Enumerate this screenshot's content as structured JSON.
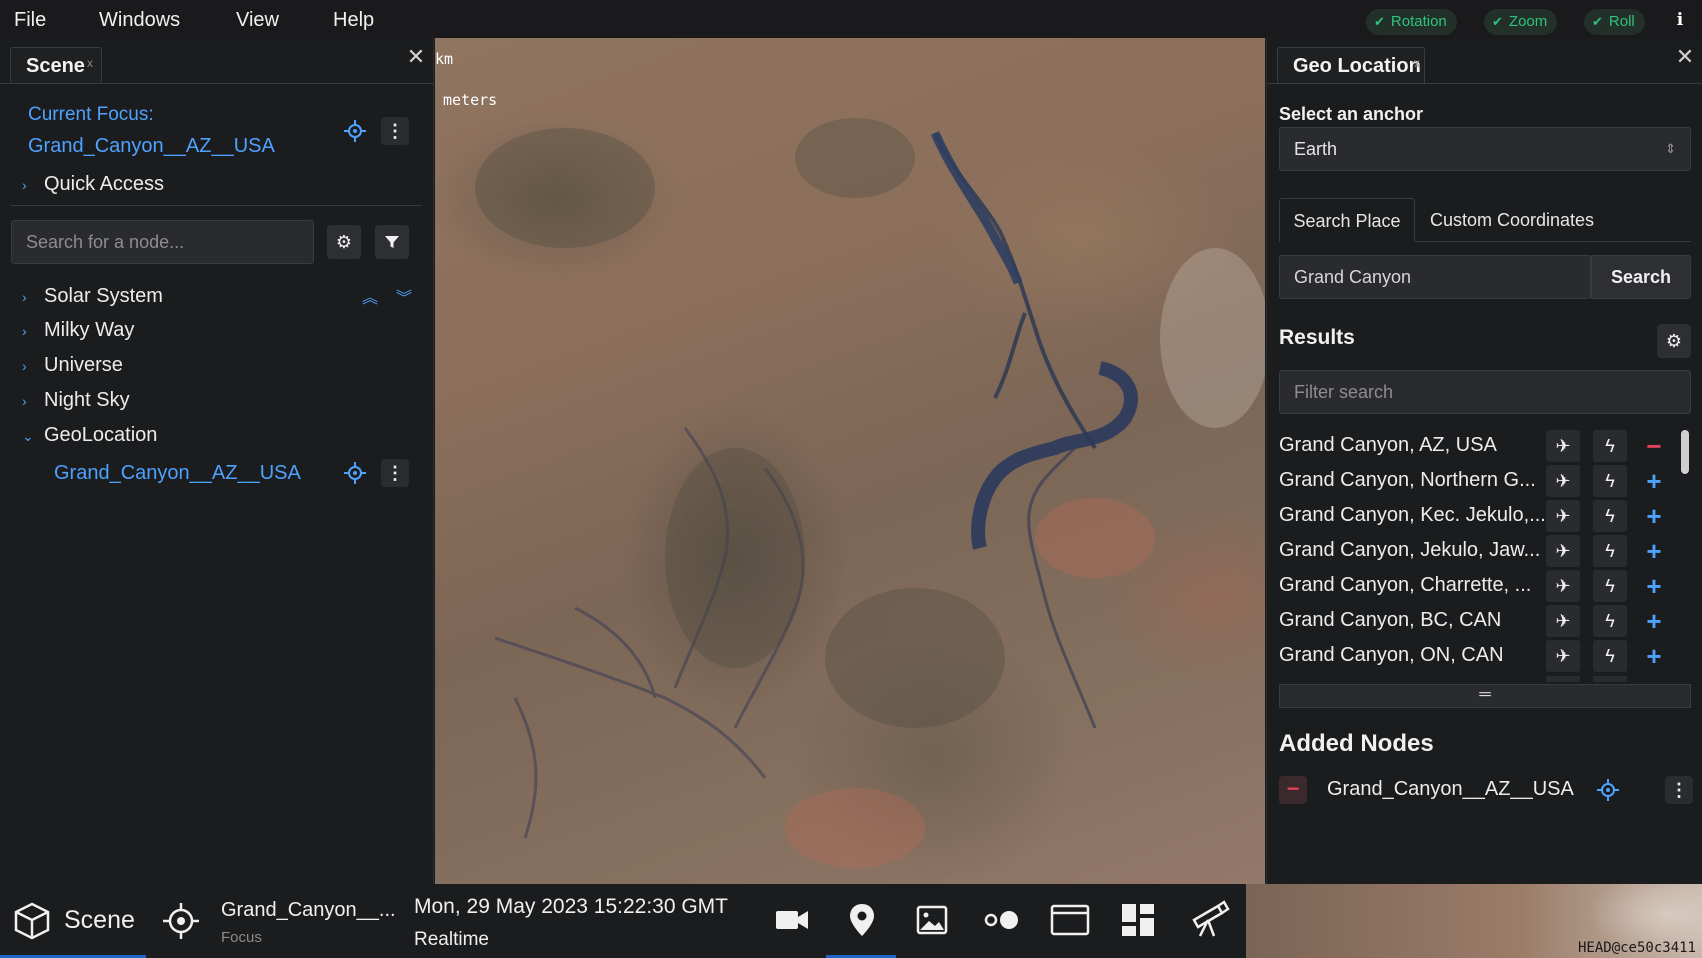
{
  "menu": {
    "file": "File",
    "windows": "Windows",
    "view": "View",
    "help": "Help"
  },
  "toggles": [
    {
      "label": "Rotation",
      "check": "✔"
    },
    {
      "label": "Zoom",
      "check": "✔"
    },
    {
      "label": "Roll",
      "check": "✔"
    }
  ],
  "info_icon": "i",
  "scene_panel": {
    "tab_title": "Scene",
    "tab_close": "x",
    "current_focus_label": "Current Focus:",
    "current_focus_value": "Grand_Canyon__AZ__USA",
    "quick_access": "Quick Access",
    "search_placeholder": "Search for a node...",
    "tree": [
      {
        "label": "Solar System",
        "chevron": "›"
      },
      {
        "label": "Milky Way",
        "chevron": "›"
      },
      {
        "label": "Universe",
        "chevron": "›"
      },
      {
        "label": "Night Sky",
        "chevron": "›"
      },
      {
        "label": "GeoLocation",
        "chevron": "⌄"
      }
    ],
    "geo_child": "Grand_Canyon__AZ__USA"
  },
  "map": {
    "scale_km": "km",
    "scale_m": "meters",
    "version": "HEAD@ce50c3411"
  },
  "geo_panel": {
    "tab_title": "Geo Location",
    "tab_close": "x",
    "anchor_label": "Select an anchor",
    "anchor_value": "Earth",
    "tabs": [
      "Search Place",
      "Custom Coordinates"
    ],
    "search_value": "Grand Canyon",
    "search_button": "Search",
    "results_title": "Results",
    "filter_placeholder": "Filter search",
    "results": [
      {
        "name": "Grand Canyon, AZ, USA",
        "action": "−"
      },
      {
        "name": "Grand Canyon, Northern G...",
        "action": "+"
      },
      {
        "name": "Grand Canyon, Kec. Jekulo,...",
        "action": "+"
      },
      {
        "name": "Grand Canyon, Jekulo, Jaw...",
        "action": "+"
      },
      {
        "name": "Grand Canyon, Charrette, ...",
        "action": "+"
      },
      {
        "name": "Grand Canyon, BC, CAN",
        "action": "+"
      },
      {
        "name": "Grand Canyon, ON, CAN",
        "action": "+"
      }
    ],
    "added_title": "Added Nodes",
    "added_nodes": [
      {
        "name": "Grand_Canyon__AZ__USA"
      }
    ]
  },
  "bottom": {
    "scene_label": "Scene",
    "focus_name": "Grand_Canyon__...",
    "focus_sub": "Focus",
    "datetime": "Mon, 29 May 2023 15:22:30 GMT",
    "time_mode": "Realtime"
  },
  "colors": {
    "accent": "#4ea2ff",
    "toggle_green": "#2ec27e",
    "remove_red": "#e0405a",
    "active_tab": "#1e66c8"
  }
}
